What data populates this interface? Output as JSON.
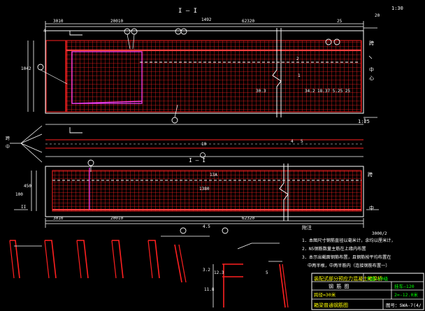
{
  "colors": {
    "background": "#000000",
    "rebar_red": "#ff2020",
    "white": "#ffffff",
    "yellow": "#ffff00",
    "magenta": "#ff40ff",
    "dim_cyan": "#00c8ff",
    "green": "#00ff00"
  },
  "scales": {
    "top_right": "1:30",
    "side": "1:25"
  },
  "section_label": "I — I",
  "plan_label": "I — I",
  "top_dims": {
    "total": "1492",
    "left_small": "3010",
    "left_mid": "20010",
    "right_span": "62320",
    "right_end": "25",
    "right_far": "20"
  },
  "bottom_dims": {
    "left_small": "3010",
    "left_mid": "20010",
    "right_span": "62320",
    "lower_note": "3000/2"
  },
  "side_dims": {
    "top_height": "1042",
    "bottom_height": "450",
    "plan_height": "100"
  },
  "labels": {
    "marker_II": "II",
    "marker_I": "I",
    "mid_label": "1380",
    "bar_a": "13A",
    "bar_b": "30.3",
    "bar_c": "34.2 18.37 5.25 25",
    "small_1": "1",
    "small_2": "2",
    "small_3": "4",
    "small_4": "5",
    "end_tag_1": "跨",
    "end_tag_2": "中",
    "end_tag_3": "心",
    "right_tag": "4.5",
    "small_dim_1": "3.2",
    "small_dim_2": "12.3",
    "small_dim_3": "11.8",
    "small_dim_4": "5",
    "top_num": "10",
    "left_num": "4"
  },
  "notes": {
    "heading": "附注",
    "line1": "1．本图尺寸钢筋直径以毫米计，余均以厘米计，",
    "line2": "2．N5钢筋数量主筋在上缘内布置",
    "line3": "3．本示出截面钢筋布置，且钢筋按平均布置在",
    "line4": "中两半根，中两半筋内（连接钢筋布置一）"
  },
  "title_block": {
    "title": "装配式部分预应力混凝土箱梁桥",
    "subtitle": "钢  筋  图",
    "span_label": "跨径=30米",
    "width_label": "桥宽",
    "code1": "汽超—20级",
    "code2": "挂车—120",
    "angle": "2=-12.0米",
    "drawing_name": "箱梁普通钢筋图",
    "drawing_no": "图号：SWA-7(4/"
  }
}
